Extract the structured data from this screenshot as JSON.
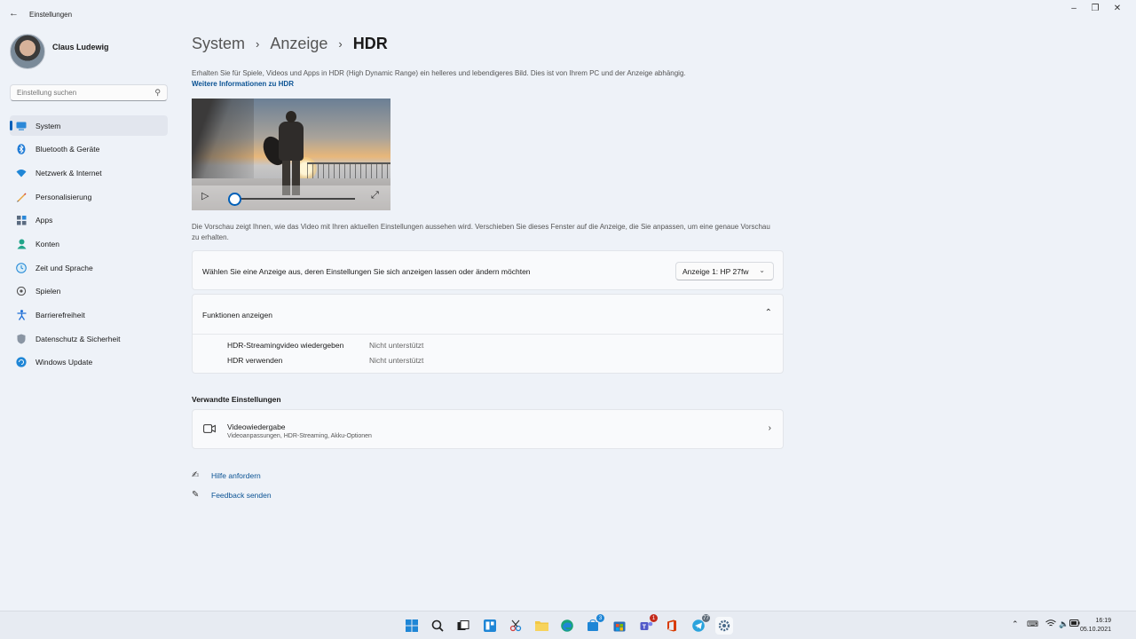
{
  "window": {
    "title": "Einstellungen",
    "back_icon": "arrow-left-icon"
  },
  "profile": {
    "name": "Claus Ludewig"
  },
  "search": {
    "placeholder": "Einstellung suchen"
  },
  "sidebar": {
    "items": [
      {
        "label": "System",
        "icon": "system-icon",
        "active": true
      },
      {
        "label": "Bluetooth & Geräte",
        "icon": "bluetooth-icon"
      },
      {
        "label": "Netzwerk & Internet",
        "icon": "wifi-icon"
      },
      {
        "label": "Personalisierung",
        "icon": "pen-icon"
      },
      {
        "label": "Apps",
        "icon": "apps-icon"
      },
      {
        "label": "Konten",
        "icon": "person-icon"
      },
      {
        "label": "Zeit und Sprache",
        "icon": "globe-clock-icon"
      },
      {
        "label": "Spielen",
        "icon": "gamepad-icon"
      },
      {
        "label": "Barrierefreiheit",
        "icon": "accessibility-icon"
      },
      {
        "label": "Datenschutz & Sicherheit",
        "icon": "shield-icon"
      },
      {
        "label": "Windows Update",
        "icon": "update-icon"
      }
    ]
  },
  "breadcrumb": {
    "level1": "System",
    "level2": "Anzeige",
    "current": "HDR"
  },
  "intro": {
    "text": "Erhalten Sie für Spiele, Videos und Apps in HDR (High Dynamic Range) ein helleres und lebendigeres Bild. Dies ist von Ihrem PC und der Anzeige abhängig.",
    "link": "Weitere Informationen zu HDR"
  },
  "preview": {
    "progress": 0,
    "description": "Die Vorschau zeigt Ihnen, wie das Video mit Ihren aktuellen Einstellungen aussehen wird. Verschieben Sie dieses Fenster auf die Anzeige, die Sie anpassen, um eine genaue Vorschau zu erhalten."
  },
  "display_select": {
    "label": "Wählen Sie eine Anzeige aus, deren Einstellungen Sie sich anzeigen lassen oder ändern möchten",
    "value": "Anzeige 1: HP 27fw"
  },
  "functions": {
    "title": "Funktionen anzeigen",
    "rows": [
      {
        "label": "HDR-Streamingvideo wiedergeben",
        "value": "Nicht unterstützt"
      },
      {
        "label": "HDR verwenden",
        "value": "Nicht unterstützt"
      }
    ]
  },
  "related": {
    "title": "Verwandte Einstellungen",
    "video": {
      "title": "Videowiedergabe",
      "subtitle": "Videoanpassungen, HDR-Streaming, Akku-Optionen"
    }
  },
  "help": {
    "get_help": "Hilfe anfordern",
    "feedback": "Feedback senden"
  },
  "taskbar": {
    "apps": [
      {
        "icon": "windows-start-icon"
      },
      {
        "icon": "search-icon"
      },
      {
        "icon": "task-view-icon"
      },
      {
        "icon": "widgets-icon"
      },
      {
        "icon": "snipping-tool-icon"
      },
      {
        "icon": "file-explorer-icon"
      },
      {
        "icon": "edge-icon"
      },
      {
        "icon": "store-icon",
        "badge": "3"
      },
      {
        "icon": "microsoft-store-icon"
      },
      {
        "icon": "teams-icon",
        "badge": "1"
      },
      {
        "icon": "office-icon"
      },
      {
        "icon": "telegram-icon",
        "badge": "77"
      },
      {
        "icon": "settings-icon"
      }
    ],
    "time": "16:19",
    "date": "05.10.2021"
  },
  "colors": {
    "accent": "#005fb8",
    "link": "#0b5394",
    "background": "#eef2f8"
  }
}
